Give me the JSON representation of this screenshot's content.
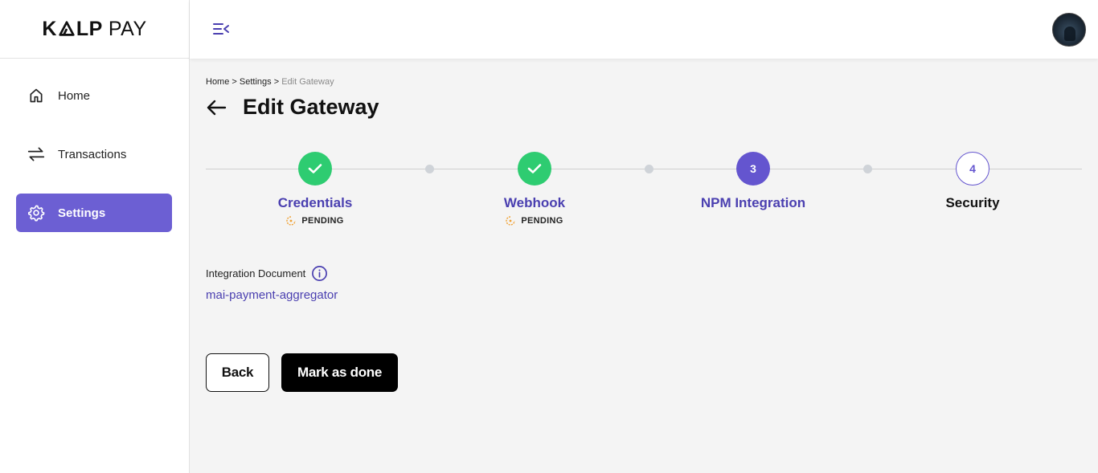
{
  "brand": {
    "logo_strong": "K LP",
    "logo_light": "PAY"
  },
  "sidebar": {
    "items": [
      {
        "label": "Home",
        "icon": "home-icon",
        "active": false
      },
      {
        "label": "Transactions",
        "icon": "transfer-arrows-icon",
        "active": false
      },
      {
        "label": "Settings",
        "icon": "gear-icon",
        "active": true
      }
    ]
  },
  "breadcrumb": {
    "home": "Home",
    "sep1": " > ",
    "settings": "Settings",
    "sep2": " > ",
    "current": "Edit Gateway"
  },
  "page": {
    "title": "Edit Gateway"
  },
  "stepper": {
    "steps": [
      {
        "label": "Credentials",
        "state": "done",
        "status": "PENDING"
      },
      {
        "label": "Webhook",
        "state": "done",
        "status": "PENDING"
      },
      {
        "label": "NPM Integration",
        "state": "current",
        "number": "3"
      },
      {
        "label": "Security",
        "state": "upcoming",
        "number": "4"
      }
    ]
  },
  "integration": {
    "label": "Integration Document",
    "link_text": "mai-payment-aggregator"
  },
  "actions": {
    "back_label": "Back",
    "done_label": "Mark as done"
  },
  "colors": {
    "accent": "#6c5fd3",
    "accent_text": "#4a3fb0",
    "success": "#2ecc71",
    "pending": "#f0a030"
  }
}
